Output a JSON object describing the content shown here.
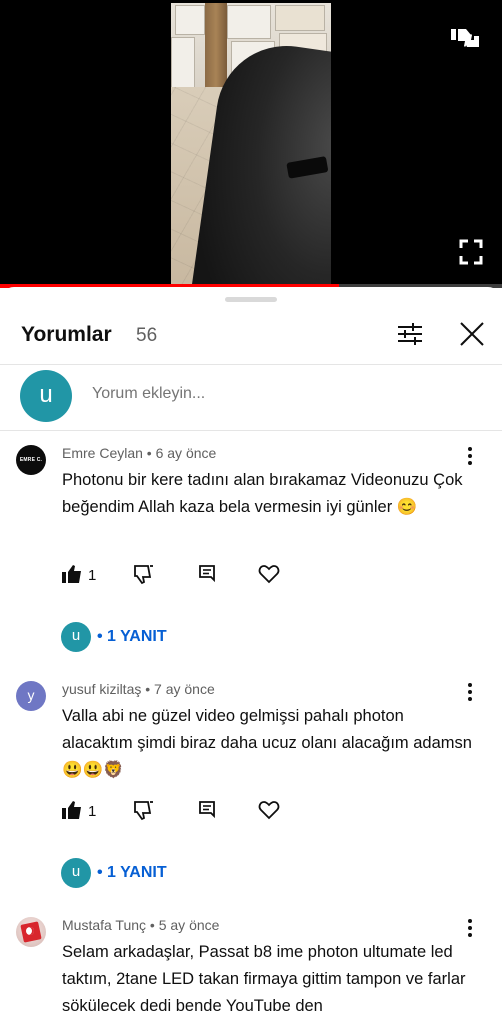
{
  "video": {
    "progress": 0.675,
    "colors": {
      "progress": "#ff0000",
      "track": "#3d3d3d"
    }
  },
  "comments_panel": {
    "title": "Yorumlar",
    "count": "56",
    "add_comment": {
      "avatar_letter": "u",
      "placeholder": "Yorum ekleyin..."
    },
    "comments": [
      {
        "author": "Emre Ceylan",
        "time": "6 ay önce",
        "meta": "Emre Ceylan • 6 ay önce",
        "avatar_text": "EMRE C.",
        "text": "Photonu bir kere tadını alan bırakamaz Videonuzu Çok beğendim Allah kaza bela vermesin iyi günler 😊",
        "likes": "1",
        "reply_avatar": "u",
        "replies_label": "• 1 YANIT"
      },
      {
        "author": "yusuf kiziltaş",
        "time": "7 ay önce",
        "meta": "yusuf kiziltaş • 7 ay önce",
        "avatar_text": "y",
        "text": "Valla abi ne güzel video gelmişsi pahalı photon alacaktım şimdi biraz daha ucuz olanı alacağım adamsn 😃😃🦁",
        "likes": "1",
        "reply_avatar": "u",
        "replies_label": "• 1 YANIT"
      },
      {
        "author": "Mustafa Tunç",
        "time": "5 ay önce",
        "meta": "Mustafa Tunç • 5 ay önce",
        "text": "Selam arkadaşlar, Passat b8 ime photon ultumate led taktım, 2tane LED takan firmaya gittim tampon ve farlar sökülecek dedi bende YouTube den"
      }
    ],
    "colors": {
      "accent": "#2196a6",
      "link": "#065fd4"
    }
  }
}
